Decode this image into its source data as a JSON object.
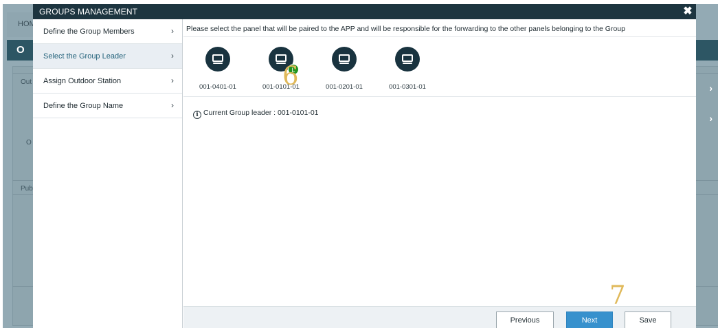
{
  "background": {
    "home_label": "HOM",
    "bar_letter": "O",
    "row_labels": [
      "Out",
      "O",
      "Pub"
    ]
  },
  "modal": {
    "title": "GROUPS MANAGEMENT",
    "close_icon": "close-icon"
  },
  "sidebar": {
    "items": [
      {
        "label": "Define the Group Members",
        "active": false
      },
      {
        "label": "Select the Group Leader",
        "active": true
      },
      {
        "label": "Assign Outdoor Station",
        "active": false
      },
      {
        "label": "Define the Group Name",
        "active": false
      }
    ]
  },
  "content": {
    "instruction": "Please select the panel that will be paired to the APP and will be responsible for the forwarding to the other panels belonging to the Group",
    "panels": [
      {
        "id": "001-0401-01",
        "leader": false
      },
      {
        "id": "001-0101-01",
        "leader": true
      },
      {
        "id": "001-0201-01",
        "leader": false
      },
      {
        "id": "001-0301-01",
        "leader": false
      }
    ],
    "leader_badge": "L",
    "current_leader_text": "Current Group leader : 001-0101-01",
    "info_icon": "i"
  },
  "annotations": {
    "step6": "6",
    "step7": "7"
  },
  "footer": {
    "previous_label": "Previous",
    "next_label": "Next",
    "save_label": "Save"
  },
  "colors": {
    "header_bg": "#1d3540",
    "panel_icon": "#19333f",
    "leader_badge": "#22941f",
    "next_button": "#3791cd",
    "annotation": "#e0b95a"
  }
}
